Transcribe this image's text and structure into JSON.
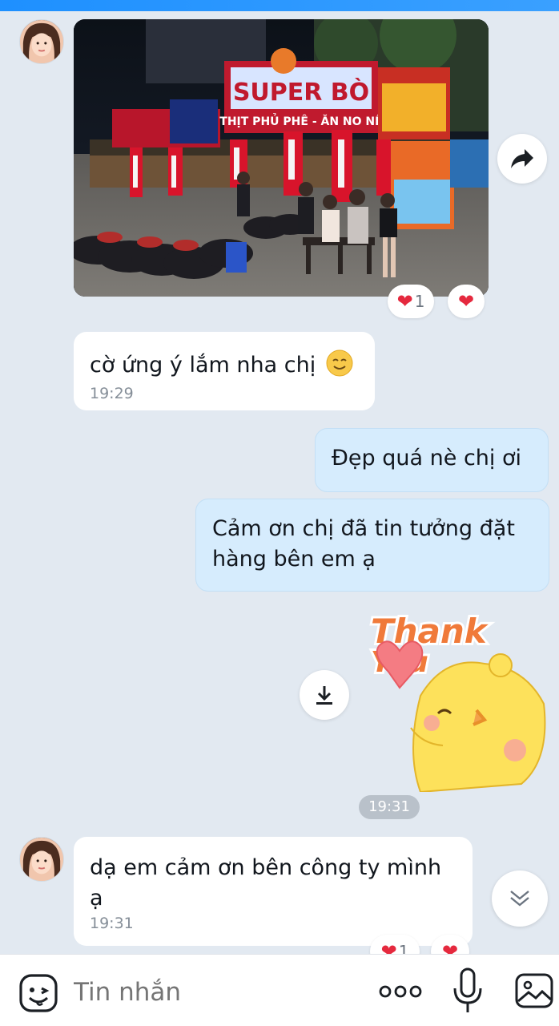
{
  "chat": {
    "photo_message": {
      "sign_title": "SUPER BÒ",
      "sign_subtitle": "THỊT PHỦ PHÊ - ĂN NO NÊ",
      "reactions": {
        "count": "1"
      }
    },
    "messages": [
      {
        "text": "cờ ứng ý lắm nha chị",
        "time": "19:29"
      },
      {
        "text": "Đẹp quá nè chị ơi"
      },
      {
        "text_line1": "Cảm ơn chị đã tin tưởng đặt",
        "text_line2": "hàng bên em ạ"
      },
      {
        "text_line1": "dạ em cảm ơn bên công ty mình",
        "text_line2": "ạ",
        "time": "19:31",
        "reaction_count": "1"
      }
    ],
    "sticker": {
      "line1": "Thank",
      "line2": "You"
    },
    "time_divider": "19:31"
  },
  "composer": {
    "placeholder": "Tin nhắn"
  },
  "colors": {
    "accent": "#1e90ff",
    "heart": "#e5293e",
    "out_bubble": "#d6ecfd",
    "background": "#e2e9f1"
  },
  "icons": [
    "forward-icon",
    "heart-icon",
    "download-icon",
    "chevron-down-icon",
    "sticker-icon",
    "more-icon",
    "mic-icon",
    "image-icon",
    "smiling-emoji-icon"
  ]
}
